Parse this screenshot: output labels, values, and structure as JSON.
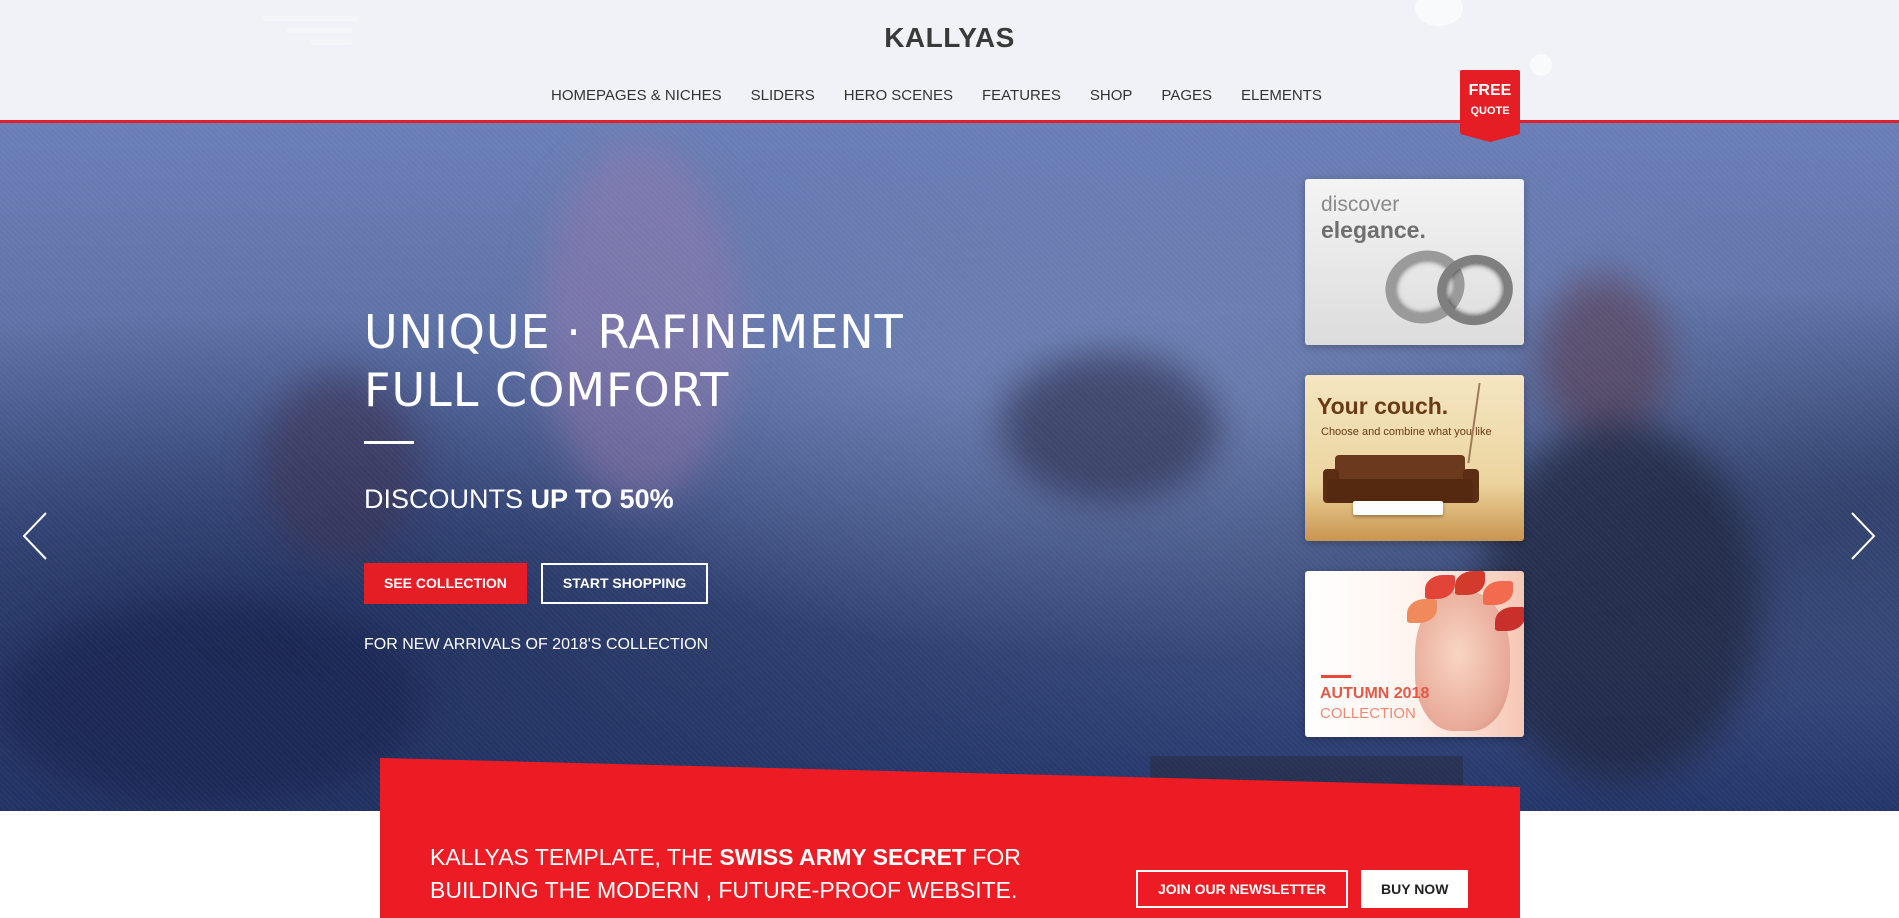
{
  "header": {
    "brand": "KALLYAS",
    "nav": [
      "HOMEPAGES & NICHES",
      "SLIDERS",
      "HERO SCENES",
      "FEATURES",
      "SHOP",
      "PAGES",
      "ELEMENTS"
    ],
    "free_quote": {
      "line1": "FREE",
      "line2": "QUOTE"
    },
    "accent_color": "#e51d25"
  },
  "hero": {
    "title_line1": "UNIQUE · RAFINEMENT",
    "title_line2": "FULL COMFORT",
    "discount_prefix": "DISCOUNTS",
    "discount_highlight": "UP TO 50%",
    "primary_button": "SEE COLLECTION",
    "secondary_button": "START SHOPPING",
    "subtext": "FOR NEW ARRIVALS OF 2018'S COLLECTION",
    "icons": {
      "prev": "chevron-left-icon",
      "next": "chevron-right-icon",
      "menu": "hamburger-menu-icon"
    }
  },
  "cards": {
    "elegance": {
      "line1": "discover",
      "line2": "elegance."
    },
    "couch": {
      "title": "Your couch.",
      "subtitle": "Choose and combine what you like"
    },
    "autumn": {
      "line1": "AUTUMN 2018",
      "line2": "COLLECTION"
    }
  },
  "banner": {
    "text_prefix": "KALLYAS TEMPLATE, THE",
    "text_highlight": "SWISS ARMY SECRET",
    "text_suffix": "FOR",
    "text_line2": "BUILDING THE MODERN , FUTURE-PROOF WEBSITE.",
    "newsletter_button": "JOIN OUR NEWSLETTER",
    "buy_button": "BUY NOW"
  }
}
